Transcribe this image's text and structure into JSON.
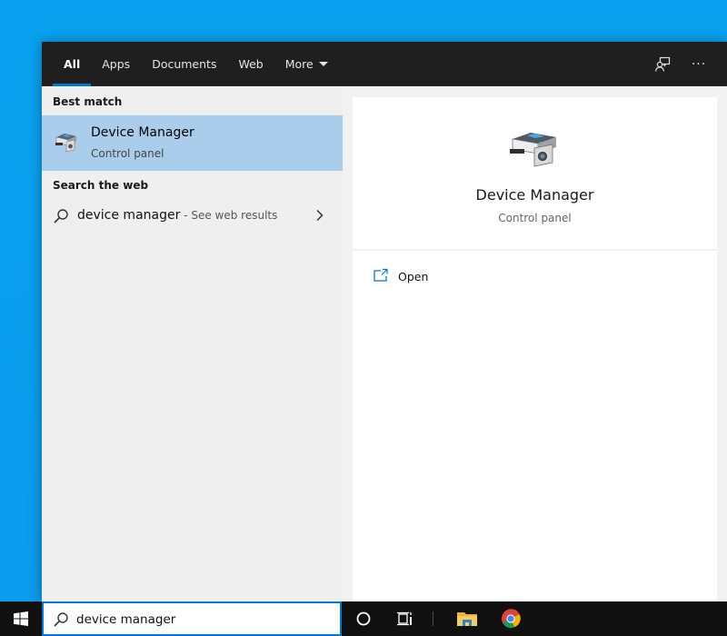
{
  "flyout": {
    "tabs": [
      {
        "label": "All",
        "active": true
      },
      {
        "label": "Apps"
      },
      {
        "label": "Documents"
      },
      {
        "label": "Web"
      },
      {
        "label": "More"
      }
    ],
    "top_icons": [
      "feedback-icon",
      "more-options-icon"
    ],
    "more_options_glyph": "···"
  },
  "results": {
    "best_match_label": "Best match",
    "best_match": {
      "title": "Device Manager",
      "subtitle": "Control panel",
      "icon": "device-manager-icon"
    },
    "search_web_label": "Search the web",
    "web_suggestion": {
      "query": "device manager",
      "hint": " - See web results"
    }
  },
  "preview": {
    "title": "Device Manager",
    "subtitle": "Control panel",
    "actions": [
      {
        "label": "Open",
        "icon": "open-icon"
      }
    ]
  },
  "taskbar": {
    "search_value": "device manager",
    "icons": [
      "windows-start-icon",
      "cortana-icon",
      "task-view-icon",
      "file-explorer-icon",
      "chrome-icon"
    ]
  },
  "colors": {
    "accent": "#0078d7",
    "selected_item": "#a9cdeb",
    "topbar": "#1f1f1f",
    "taskbar": "#101010",
    "desktop": "#0aa2f0"
  }
}
